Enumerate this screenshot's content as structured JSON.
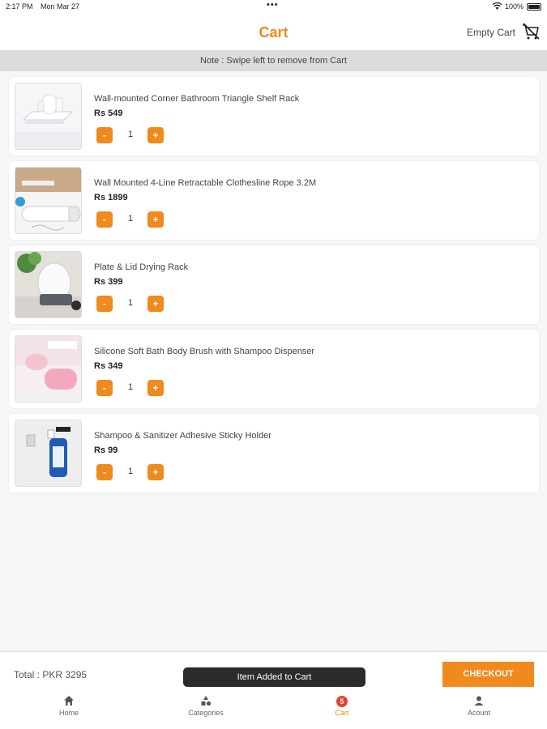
{
  "status": {
    "time": "2:17 PM",
    "date": "Mon Mar 27",
    "battery": "100%"
  },
  "header": {
    "title": "Cart",
    "empty_cart": "Empty Cart"
  },
  "note": "Note : Swipe left to remove from Cart",
  "items": [
    {
      "name": "Wall-mounted Corner Bathroom Triangle Shelf Rack",
      "price": "Rs 549",
      "qty": "1",
      "minus": "-",
      "plus": "+"
    },
    {
      "name": "Wall Mounted 4-Line Retractable Clothesline Rope 3.2M",
      "price": "Rs 1899",
      "qty": "1",
      "minus": "-",
      "plus": "+"
    },
    {
      "name": "Plate & Lid Drying Rack",
      "price": "Rs 399",
      "qty": "1",
      "minus": "-",
      "plus": "+"
    },
    {
      "name": "Silicone Soft Bath Body Brush with Shampoo Dispenser",
      "price": "Rs 349",
      "qty": "1",
      "minus": "-",
      "plus": "+"
    },
    {
      "name": "Shampoo & Sanitizer Adhesive Sticky Holder",
      "price": "Rs 99",
      "qty": "1",
      "minus": "-",
      "plus": "+"
    }
  ],
  "footer": {
    "total": "Total : PKR 3295",
    "toast": "Item Added to Cart",
    "checkout": "CHECKOUT"
  },
  "tabs": [
    {
      "label": "Home",
      "icon": "home-icon"
    },
    {
      "label": "Categories",
      "icon": "categories-icon"
    },
    {
      "label": "Cart",
      "icon": "cart-icon",
      "badge": "5",
      "active": true
    },
    {
      "label": "Acount",
      "icon": "account-icon"
    }
  ],
  "colors": {
    "accent": "#f08a1d",
    "badge": "#e8442b",
    "toast": "#2b2b2b"
  }
}
